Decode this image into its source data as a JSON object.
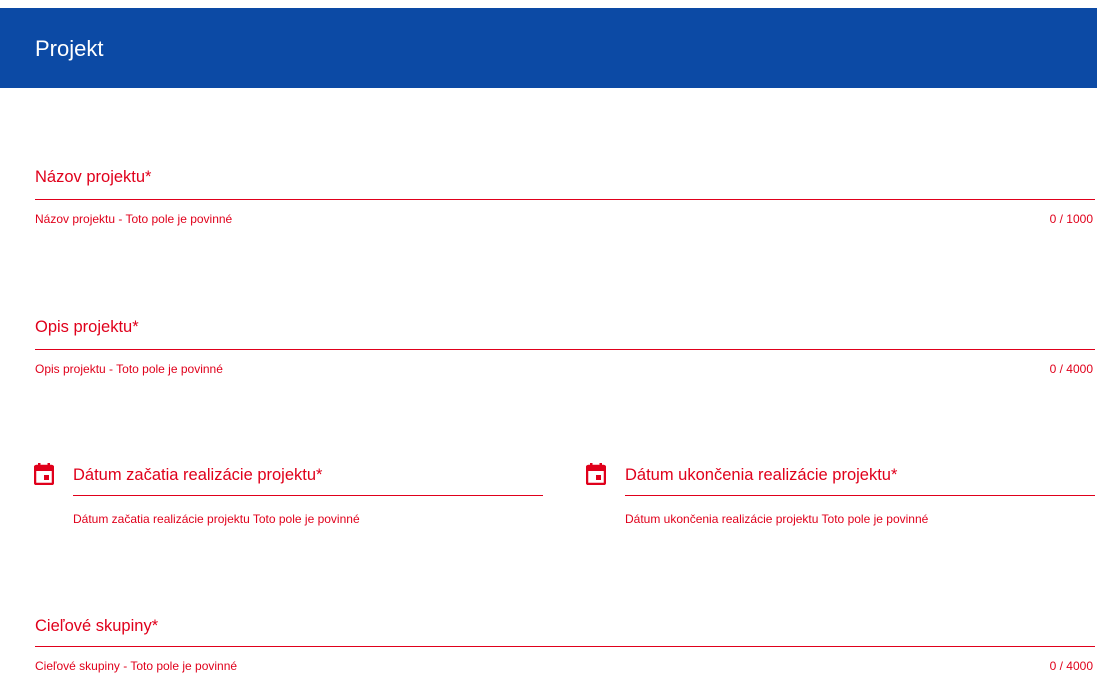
{
  "header": {
    "title": "Projekt"
  },
  "fields": {
    "project_name": {
      "label": "Názov projektu*",
      "hint": "Názov projektu - Toto pole je povinné",
      "counter": "0 / 1000"
    },
    "project_description": {
      "label": "Opis projektu*",
      "hint": "Opis projektu - Toto pole je povinné",
      "counter": "0 / 4000"
    },
    "start_date": {
      "label": "Dátum začatia realizácie projektu*",
      "hint": "Dátum začatia realizácie projektu Toto pole je povinné",
      "icon": "calendar-icon"
    },
    "end_date": {
      "label": "Dátum ukončenia realizácie projektu*",
      "hint": "Dátum ukončenia realizácie projektu Toto pole je povinné",
      "icon": "calendar-icon"
    },
    "target_groups": {
      "label": "Cieľové skupiny*",
      "hint": "Cieľové skupiny - Toto pole je povinné",
      "counter": "0 / 4000"
    }
  },
  "colors": {
    "header_bg": "#0c4aa5",
    "error": "#e0001b"
  }
}
